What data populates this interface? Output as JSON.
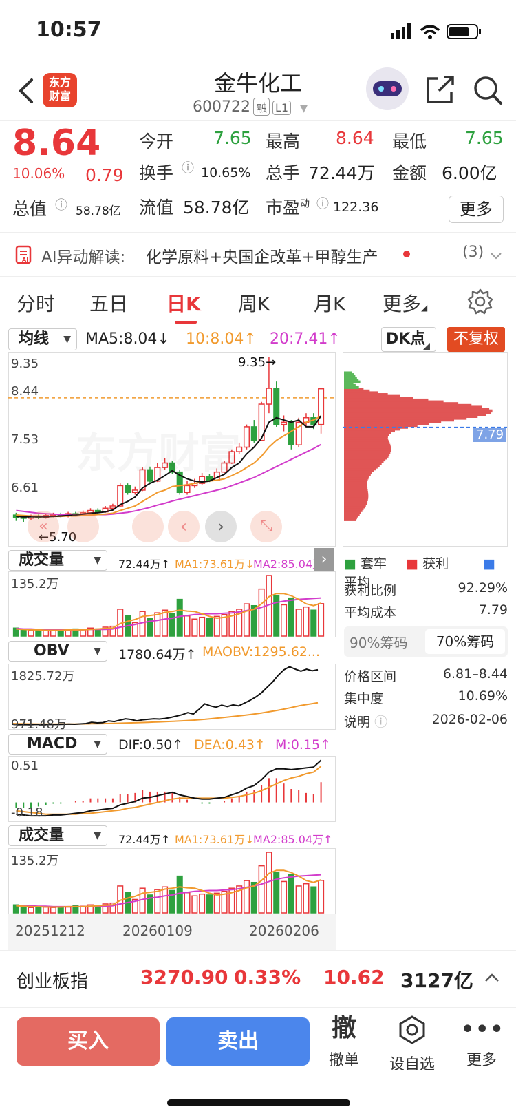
{
  "status": {
    "time": "10:57"
  },
  "header": {
    "logo_text": "东方\n财富",
    "logo_line1": "东方",
    "logo_line2": "财富",
    "stock_name": "金牛化工",
    "stock_code": "600722",
    "tag_rong": "融",
    "tag_level": "L1",
    "icons": [
      "back-icon",
      "robot-avatar-icon",
      "share-icon",
      "search-icon"
    ]
  },
  "quote": {
    "price": "8.64",
    "change_pct": "10.06%",
    "change": "0.79",
    "open_label": "今开",
    "open": "7.65",
    "high_label": "最高",
    "high": "8.64",
    "low_label": "最低",
    "low": "7.65",
    "turnover_label": "换手",
    "turnover": "10.65%",
    "volume_label": "总手",
    "volume": "72.44万",
    "amount_label": "金额",
    "amount": "6.00亿",
    "mktcap_label": "总值",
    "mktcap": "58.78亿",
    "float_label": "流值",
    "float": "58.78亿",
    "pe_label": "市盈",
    "pe_sup": "动",
    "pe": "122.36",
    "more_label": "更多"
  },
  "ai": {
    "prefix": "AI异动解读:",
    "text": "化学原料+央国企改革+甲醇生产",
    "count": "(3)"
  },
  "tabs": [
    "分时",
    "五日",
    "日K",
    "周K",
    "月K",
    "更多"
  ],
  "kline": {
    "indicator_select": "均线",
    "ma5": "MA5:8.04",
    "ma10": "10:8.04",
    "ma20": "20:7.41",
    "dk_select": "DK点",
    "adjust_button": "不复权",
    "y_labels": [
      "9.35",
      "8.44",
      "7.53",
      "6.61"
    ],
    "high_marker": "9.35",
    "low_marker": "5.70",
    "watermark": "东方财富",
    "colors": {
      "up": "#e8373a",
      "down": "#2ea13f",
      "ma5": "#111111",
      "ma10": "#f19a2e",
      "ma20": "#d23ccb"
    }
  },
  "volume1": {
    "select": "成交量",
    "vol": "72.44万",
    "ma1": "MA1:73.61万",
    "ma2": "MA2:85.04万",
    "top_label": "135.2万"
  },
  "obv": {
    "select": "OBV",
    "value": "1780.64万",
    "maobv": "MAOBV:1295.62...",
    "top_label": "1825.72万",
    "bottom_label": "971.48万"
  },
  "macd": {
    "select": "MACD",
    "dif": "DIF:0.50",
    "dea": "DEA:0.43",
    "m": "M:0.15",
    "top_label": "0.51",
    "bottom_label": "-0.18"
  },
  "volume2": {
    "select": "成交量",
    "vol": "72.44万",
    "ma1": "MA1:73.61万",
    "ma2": "MA2:85.04万",
    "top_label": "135.2万",
    "dates": [
      "20251212",
      "20260109",
      "20260206"
    ]
  },
  "chips": {
    "current_price": "7.79",
    "legend": [
      "套牢",
      "获利",
      "平均"
    ],
    "profit_ratio_label": "获利比例",
    "profit_ratio": "92.29%",
    "avg_cost_label": "平均成本",
    "avg_cost": "7.79",
    "tab90": "90%筹码",
    "tab70": "70%筹码",
    "range_label": "价格区间",
    "range": "6.81–8.44",
    "concentration_label": "集中度",
    "concentration": "10.69%",
    "note_label": "说明",
    "date": "2026-02-06"
  },
  "index_bar": {
    "name": "创业板指",
    "value": "3270.90",
    "pct": "0.33%",
    "change": "10.62",
    "amount": "3127亿"
  },
  "actions": {
    "buy": "买入",
    "sell": "卖出",
    "cancel_glyph": "撤",
    "cancel": "撤单",
    "watch": "设自选",
    "more": "更多"
  },
  "chart_data": {
    "type": "candlestick",
    "y_range": [
      5.7,
      9.35
    ],
    "candles": [
      [
        5.85,
        5.8,
        5.9,
        5.72
      ],
      [
        5.8,
        5.78,
        5.85,
        5.7
      ],
      [
        5.78,
        5.82,
        5.86,
        5.74
      ],
      [
        5.82,
        5.8,
        5.86,
        5.76
      ],
      [
        5.8,
        5.84,
        5.88,
        5.77
      ],
      [
        5.84,
        5.86,
        5.9,
        5.8
      ],
      [
        5.86,
        5.83,
        5.9,
        5.8
      ],
      [
        5.83,
        5.88,
        5.92,
        5.8
      ],
      [
        5.88,
        5.86,
        5.92,
        5.82
      ],
      [
        5.86,
        5.9,
        5.95,
        5.84
      ],
      [
        5.9,
        5.95,
        6.0,
        5.86
      ],
      [
        5.95,
        5.92,
        6.0,
        5.88
      ],
      [
        5.92,
        6.0,
        6.05,
        5.9
      ],
      [
        6.0,
        6.05,
        6.1,
        5.96
      ],
      [
        6.05,
        6.5,
        6.55,
        6.02
      ],
      [
        6.5,
        6.35,
        6.55,
        6.3
      ],
      [
        6.35,
        6.4,
        6.48,
        6.3
      ],
      [
        6.4,
        6.85,
        6.9,
        6.38
      ],
      [
        6.85,
        6.6,
        6.92,
        6.55
      ],
      [
        6.6,
        6.9,
        7.0,
        6.58
      ],
      [
        6.9,
        7.0,
        7.1,
        6.85
      ],
      [
        7.0,
        6.8,
        7.05,
        6.75
      ],
      [
        6.8,
        6.35,
        6.85,
        6.3
      ],
      [
        6.35,
        6.5,
        6.6,
        6.3
      ],
      [
        6.5,
        6.55,
        6.65,
        6.45
      ],
      [
        6.55,
        6.7,
        6.78,
        6.52
      ],
      [
        6.7,
        6.62,
        6.75,
        6.58
      ],
      [
        6.62,
        6.8,
        6.88,
        6.6
      ],
      [
        6.8,
        7.0,
        7.05,
        6.78
      ],
      [
        7.0,
        7.25,
        7.3,
        6.98
      ],
      [
        7.25,
        7.35,
        7.45,
        7.2
      ],
      [
        7.35,
        7.8,
        7.85,
        7.3
      ],
      [
        7.8,
        7.5,
        7.95,
        7.45
      ],
      [
        7.5,
        8.3,
        8.35,
        7.48
      ],
      [
        8.3,
        8.65,
        9.35,
        8.1
      ],
      [
        8.65,
        7.85,
        8.8,
        7.8
      ],
      [
        7.85,
        7.9,
        8.05,
        7.7
      ],
      [
        7.9,
        7.4,
        7.95,
        7.3
      ],
      [
        7.4,
        7.9,
        8.0,
        7.35
      ],
      [
        7.9,
        8.0,
        8.1,
        7.8
      ],
      [
        8.0,
        7.85,
        8.1,
        7.75
      ],
      [
        7.85,
        8.64,
        8.64,
        7.65
      ]
    ],
    "ma5": [
      5.82,
      5.81,
      5.81,
      5.81,
      5.81,
      5.82,
      5.83,
      5.84,
      5.85,
      5.87,
      5.89,
      5.9,
      5.92,
      5.96,
      6.08,
      6.15,
      6.25,
      6.45,
      6.55,
      6.62,
      6.72,
      6.83,
      6.73,
      6.65,
      6.6,
      6.58,
      6.6,
      6.68,
      6.75,
      6.9,
      7.0,
      7.2,
      7.35,
      7.55,
      7.9,
      8.0,
      7.95,
      7.9,
      7.95,
      7.8,
      7.8,
      8.04
    ],
    "ma10": [
      5.85,
      5.84,
      5.83,
      5.83,
      5.82,
      5.82,
      5.82,
      5.83,
      5.83,
      5.84,
      5.85,
      5.86,
      5.87,
      5.89,
      5.95,
      6.0,
      6.05,
      6.15,
      6.25,
      6.35,
      6.4,
      6.48,
      6.5,
      6.52,
      6.55,
      6.58,
      6.6,
      6.62,
      6.65,
      6.72,
      6.8,
      6.9,
      7.0,
      7.15,
      7.35,
      7.5,
      7.6,
      7.7,
      7.8,
      7.9,
      7.95,
      8.04
    ],
    "ma20": [
      5.95,
      5.93,
      5.91,
      5.89,
      5.88,
      5.87,
      5.86,
      5.86,
      5.85,
      5.85,
      5.85,
      5.86,
      5.86,
      5.87,
      5.89,
      5.91,
      5.94,
      5.98,
      6.02,
      6.07,
      6.11,
      6.16,
      6.2,
      6.24,
      6.28,
      6.32,
      6.36,
      6.4,
      6.44,
      6.5,
      6.56,
      6.62,
      6.68,
      6.76,
      6.84,
      6.92,
      7.0,
      7.08,
      7.16,
      7.24,
      7.32,
      7.41
    ],
    "volume": [
      18,
      15,
      12,
      14,
      13,
      12,
      14,
      13,
      16,
      15,
      18,
      16,
      20,
      22,
      60,
      45,
      30,
      55,
      40,
      52,
      58,
      50,
      82,
      45,
      38,
      42,
      40,
      44,
      48,
      55,
      60,
      72,
      68,
      105,
      135.2,
      90,
      70,
      85,
      60,
      65,
      58,
      72.44
    ],
    "volume_ma1": [
      16,
      15,
      14,
      14,
      13,
      13,
      13,
      14,
      14,
      14,
      15,
      16,
      17,
      18,
      28,
      33,
      37,
      44,
      46,
      48,
      53,
      55,
      58,
      56,
      55,
      50,
      44,
      40,
      42,
      45,
      50,
      56,
      60,
      72,
      88,
      95,
      95,
      90,
      82,
      72,
      68,
      73.61
    ],
    "volume_ma2": [
      17,
      16,
      16,
      15,
      15,
      14,
      14,
      14,
      14,
      14,
      15,
      15,
      15,
      16,
      20,
      23,
      26,
      30,
      33,
      35,
      38,
      40,
      44,
      46,
      48,
      49,
      50,
      50,
      51,
      52,
      54,
      57,
      60,
      64,
      70,
      75,
      78,
      80,
      82,
      83,
      84,
      85.04
    ],
    "obv": [
      980,
      972,
      975,
      973,
      976,
      978,
      975,
      978,
      976,
      979,
      983,
      980,
      985,
      990,
      1010,
      1000,
      1005,
      1030,
      1020,
      1040,
      1060,
      1050,
      1030,
      1045,
      1052,
      1060,
      1056,
      1065,
      1080,
      1100,
      1120,
      1150,
      1130,
      1200,
      1280,
      1250,
      1230,
      1260,
      1240,
      1265,
      1250,
      1290,
      1330,
      1380,
      1440,
      1520,
      1600,
      1700,
      1780,
      1825,
      1790,
      1760,
      1790,
      1765,
      1780.64
    ],
    "maobv": [
      990,
      988,
      986,
      985,
      984,
      983,
      983,
      982,
      982,
      982,
      983,
      983,
      984,
      985,
      987,
      988,
      989,
      991,
      993,
      995,
      998,
      1000,
      1003,
      1006,
      1009,
      1012,
      1015,
      1018,
      1022,
      1026,
      1030,
      1035,
      1040,
      1046,
      1052,
      1060,
      1068,
      1076,
      1085,
      1094,
      1103,
      1112,
      1122,
      1133,
      1145,
      1158,
      1172,
      1187,
      1203,
      1220,
      1238,
      1256,
      1270,
      1283,
      1295.62
    ],
    "macd_dif": [
      -0.14,
      -0.15,
      -0.16,
      -0.16,
      -0.16,
      -0.15,
      -0.15,
      -0.14,
      -0.13,
      -0.12,
      -0.1,
      -0.09,
      -0.08,
      -0.07,
      -0.03,
      -0.01,
      0.01,
      0.05,
      0.06,
      0.08,
      0.1,
      0.12,
      0.09,
      0.07,
      0.05,
      0.04,
      0.04,
      0.05,
      0.06,
      0.09,
      0.12,
      0.17,
      0.2,
      0.27,
      0.36,
      0.4,
      0.4,
      0.39,
      0.4,
      0.41,
      0.42,
      0.5
    ],
    "macd_dea": [
      -0.1,
      -0.11,
      -0.12,
      -0.13,
      -0.14,
      -0.14,
      -0.14,
      -0.14,
      -0.14,
      -0.13,
      -0.13,
      -0.12,
      -0.11,
      -0.1,
      -0.09,
      -0.07,
      -0.06,
      -0.04,
      -0.02,
      0.0,
      0.02,
      0.04,
      0.05,
      0.05,
      0.05,
      0.05,
      0.05,
      0.05,
      0.05,
      0.06,
      0.07,
      0.09,
      0.11,
      0.14,
      0.18,
      0.22,
      0.26,
      0.29,
      0.31,
      0.34,
      0.36,
      0.43
    ],
    "macd_m": [
      -0.04,
      -0.04,
      -0.04,
      -0.03,
      -0.02,
      -0.01,
      -0.01,
      0.0,
      0.01,
      0.01,
      0.03,
      0.03,
      0.03,
      0.03,
      0.06,
      0.06,
      0.07,
      0.09,
      0.08,
      0.08,
      0.08,
      0.08,
      0.04,
      0.02,
      0.0,
      -0.01,
      -0.01,
      0.0,
      0.01,
      0.03,
      0.05,
      0.08,
      0.09,
      0.13,
      0.18,
      0.18,
      0.14,
      0.1,
      0.09,
      0.07,
      0.06,
      0.15
    ],
    "chips_profit_fraction": 0.9229
  }
}
